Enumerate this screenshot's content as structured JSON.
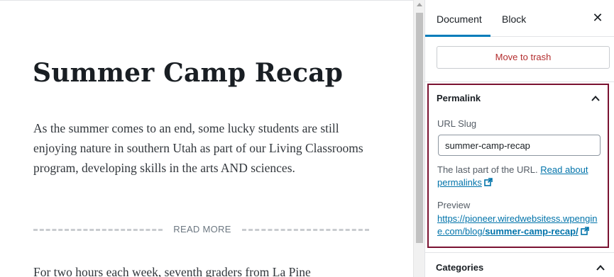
{
  "editor": {
    "title": "Summer Camp Recap",
    "paragraph1": "As the summer comes to an end, some lucky students are still enjoying nature in southern Utah as part of our Living Classrooms program, developing skills in the arts AND sciences.",
    "read_more": "READ MORE",
    "paragraph2": "For two hours each week, seventh graders from La Pine"
  },
  "sidebar": {
    "tabs": [
      {
        "label": "Document",
        "active": true
      },
      {
        "label": "Block",
        "active": false
      }
    ],
    "close_icon": "close-icon",
    "trash_label": "Move to trash",
    "permalink": {
      "title": "Permalink",
      "url_slug_label": "URL Slug",
      "url_slug_value": "summer-camp-recap",
      "help_text": "The last part of the URL.",
      "help_link": "Read about permalinks",
      "preview_label": "Preview",
      "preview_url_base": "https://pioneer.wiredwebsitess.wpengine.com/blog/",
      "preview_url_slug": "summer-camp-recap/",
      "external_icon": "external-link-icon"
    },
    "categories_title": "Categories"
  },
  "colors": {
    "accent": "#007cba",
    "link": "#0073aa",
    "danger": "#b32d2e",
    "highlight_border": "#7a1231"
  }
}
